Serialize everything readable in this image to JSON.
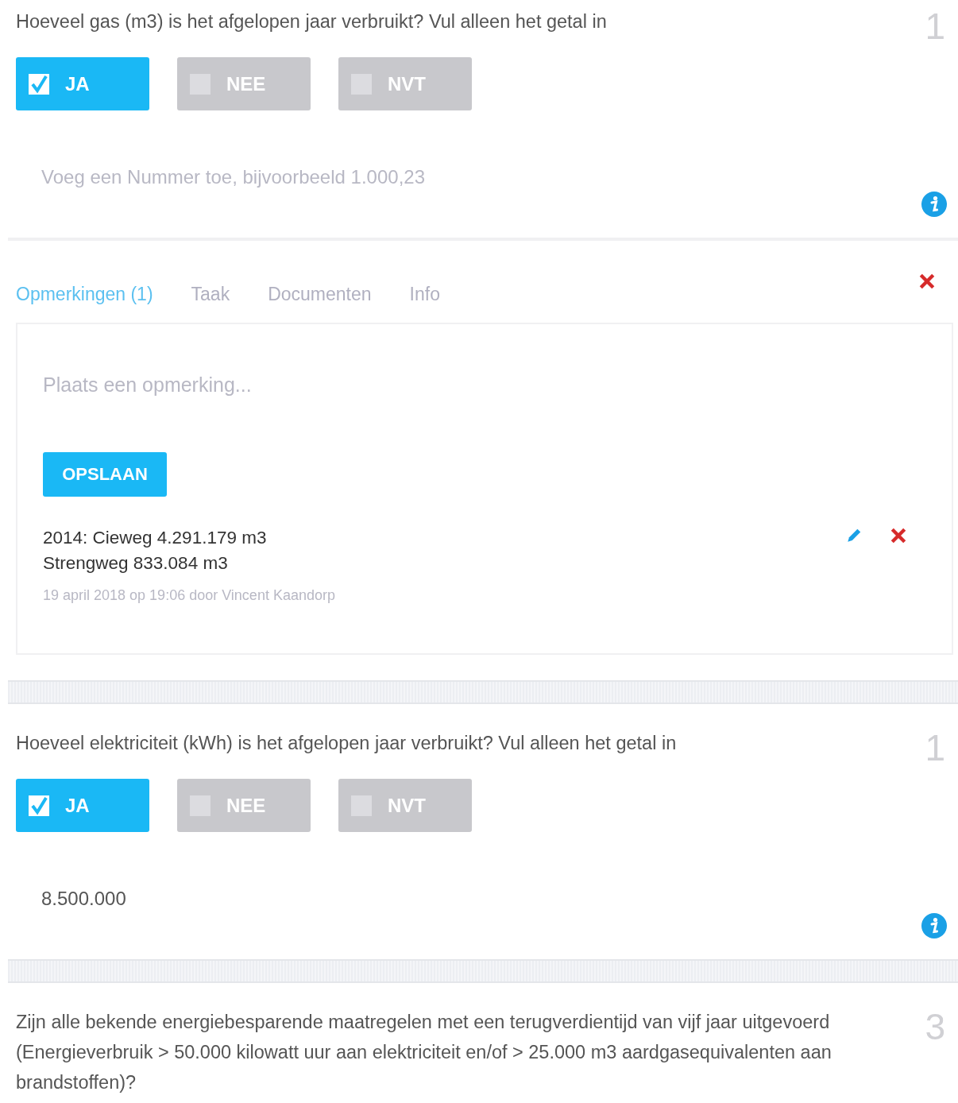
{
  "questions": [
    {
      "text": "Hoeveel gas (m3) is het afgelopen jaar verbruikt? Vul alleen het getal in",
      "number": "1",
      "options": [
        {
          "label": "JA",
          "selected": true
        },
        {
          "label": "NEE",
          "selected": false
        },
        {
          "label": "NVT",
          "selected": false
        }
      ],
      "answer": {
        "placeholder": "Voeg een Nummer toe, bijvoorbeeld 1.000,23"
      },
      "panel": {
        "tabs": [
          {
            "label": "Opmerkingen (1)",
            "selected": true
          },
          {
            "label": "Taak",
            "selected": false
          },
          {
            "label": "Documenten",
            "selected": false
          },
          {
            "label": "Info",
            "selected": false
          }
        ],
        "comment_field": {
          "placeholder": "Plaats een opmerking..."
        },
        "save_button": "OPSLAAN",
        "comments": [
          {
            "lines": [
              "2014: Cieweg 4.291.179 m3",
              "Strengweg 833.084 m3"
            ],
            "meta": "19 april 2018 op 19:06 door Vincent Kaandorp"
          }
        ]
      }
    },
    {
      "text": "Hoeveel elektriciteit (kWh) is het afgelopen jaar verbruikt? Vul alleen het getal in",
      "number": "1",
      "options": [
        {
          "label": "JA",
          "selected": true
        },
        {
          "label": "NEE",
          "selected": false
        },
        {
          "label": "NVT",
          "selected": false
        }
      ],
      "answer": {
        "value": "8.500.000"
      }
    },
    {
      "text": "Zijn alle bekende energiebesparende maatregelen met een terugverdientijd van vijf jaar uitgevoerd (Energieverbruik > 50.000 kilowatt uur aan elektriciteit en/of > 25.000 m3 aardgasequivalenten aan brandstoffen)?",
      "number": "3"
    }
  ]
}
